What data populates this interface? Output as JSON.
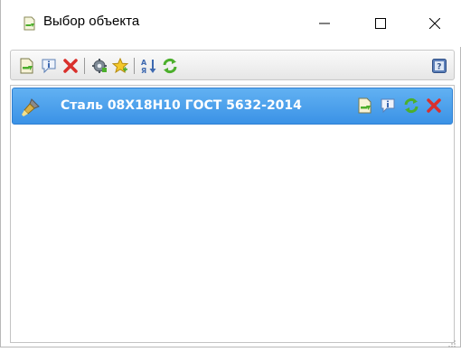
{
  "window": {
    "title": "Выбор объекта",
    "minimize_glyph": "—",
    "maximize_glyph": "☐",
    "close_glyph": "✕"
  },
  "toolbar": {
    "buttons": [
      {
        "icon": "open-document-icon"
      },
      {
        "icon": "info-icon"
      },
      {
        "icon": "delete-icon"
      },
      {
        "icon": "settings-gear-icon"
      },
      {
        "icon": "add-star-icon"
      },
      {
        "icon": "sort-icon"
      },
      {
        "icon": "refresh-icon"
      },
      {
        "icon": "help-icon"
      }
    ],
    "sort_glyph": "A↓",
    "help_glyph": "?"
  },
  "list": {
    "items": [
      {
        "label": "Сталь 08Х18Н10 ГОСТ 5632-2014",
        "selected": true,
        "actions": [
          "open-document-icon",
          "info-icon",
          "refresh-icon",
          "delete-icon"
        ]
      }
    ]
  },
  "colors": {
    "selection": "#3b92e6",
    "delete": "#d9302c",
    "refresh": "#4caf2c"
  }
}
